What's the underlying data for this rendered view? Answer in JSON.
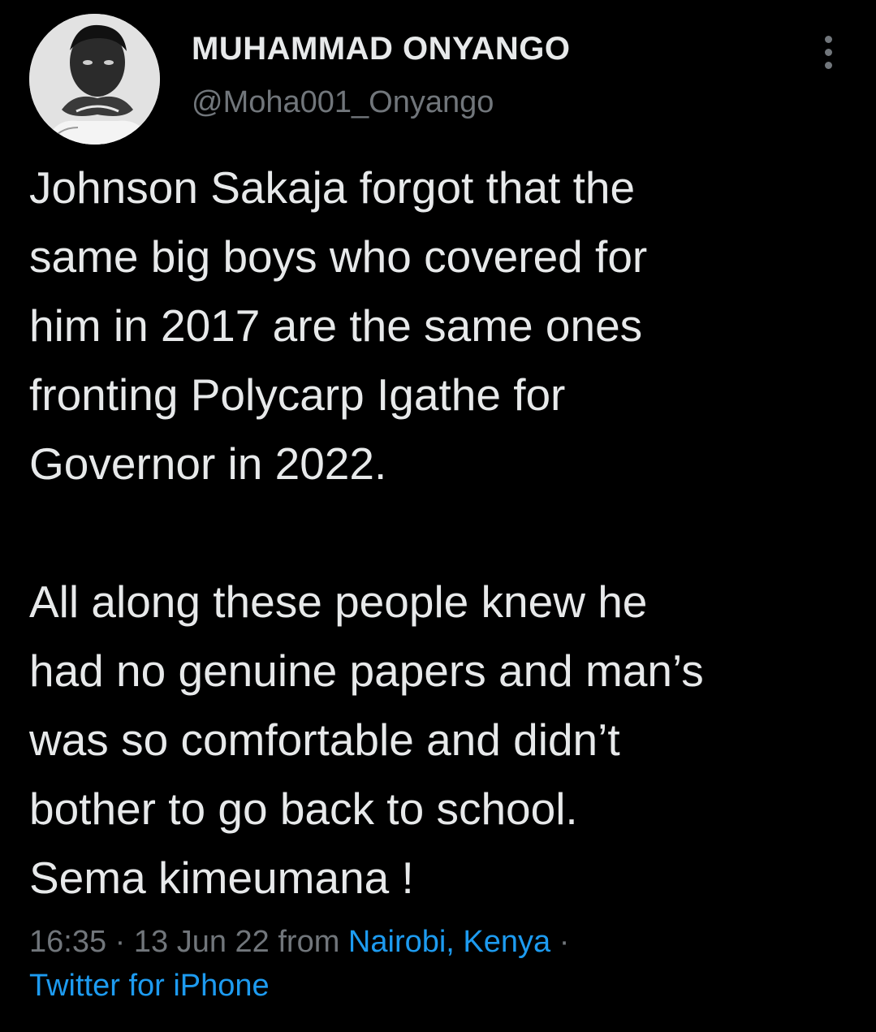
{
  "author": {
    "display_name": "MUHAMMAD ONYANGO",
    "handle": "@Moha001_Onyango",
    "avatar_icon": "person-portrait-icon"
  },
  "more_icon": "more-vertical-icon",
  "tweet": {
    "paragraph_1": "Johnson Sakaja forgot that the\nsame big boys who covered for\nhim in 2017 are the same ones\nfronting Polycarp Igathe for\nGovernor in 2022.",
    "paragraph_2": "All along these people knew he\nhad no genuine papers and man’s\nwas so comfortable and didn’t\nbother to go back to school.\nSema kimeumana !"
  },
  "meta": {
    "time": "16:35",
    "separator": " · ",
    "date": "13 Jun 22",
    "from_label": " from ",
    "location": "Nairobi, Kenya",
    "trailing_separator": " ·",
    "source": "Twitter for iPhone"
  },
  "colors": {
    "background": "#000000",
    "text": "#e7e9ea",
    "secondary": "#71767b",
    "link": "#1d9bf0"
  }
}
